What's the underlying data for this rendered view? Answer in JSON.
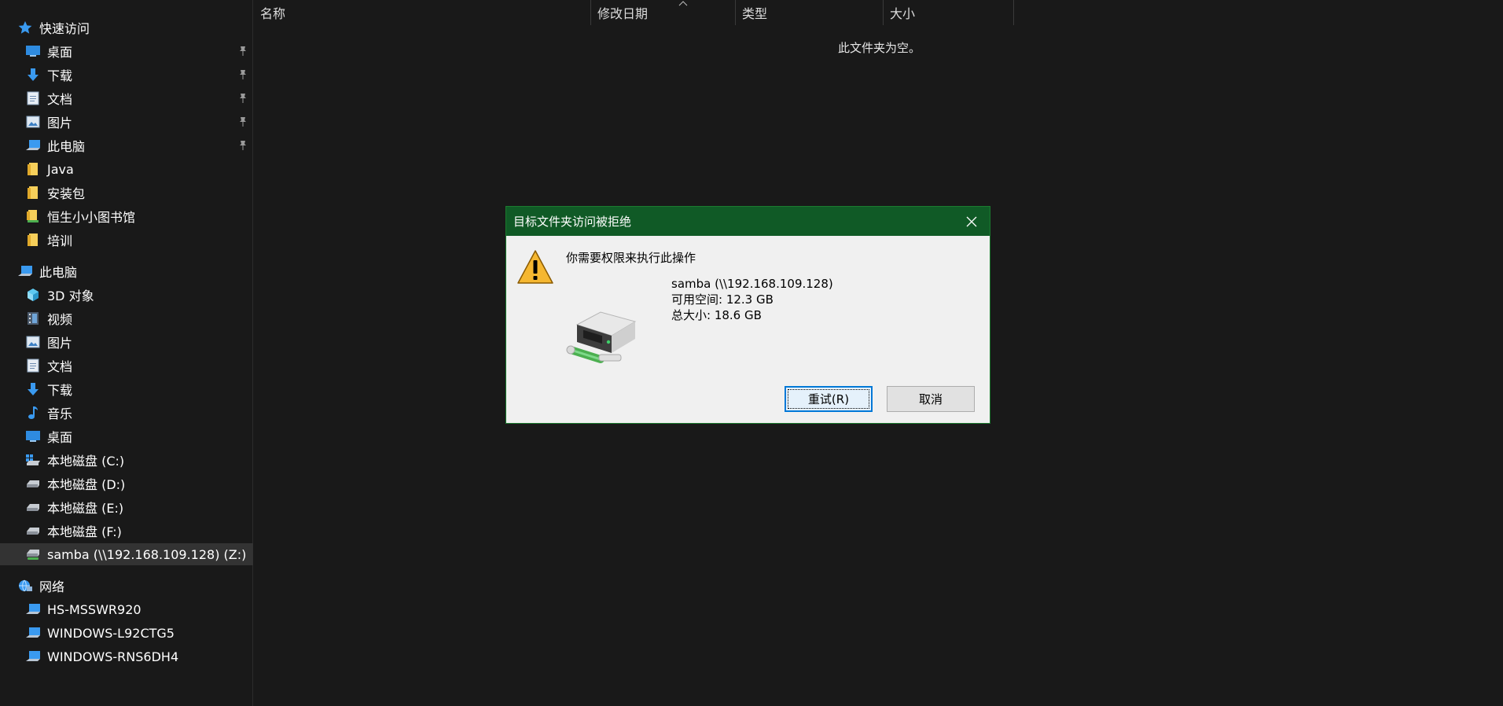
{
  "sidebar": {
    "quick_access": {
      "label": "快速访问",
      "items": [
        {
          "label": "桌面",
          "icon": "desktop-icon"
        },
        {
          "label": "下载",
          "icon": "download-icon"
        },
        {
          "label": "文档",
          "icon": "document-icon"
        },
        {
          "label": "图片",
          "icon": "pictures-icon"
        },
        {
          "label": "此电脑",
          "icon": "computer-icon"
        },
        {
          "label": "Java",
          "icon": "folder-icon"
        },
        {
          "label": "安装包",
          "icon": "folder-icon"
        },
        {
          "label": "恒生小小图书馆",
          "icon": "folder-icon"
        },
        {
          "label": "培训",
          "icon": "folder-icon"
        }
      ]
    },
    "this_pc": {
      "label": "此电脑",
      "items": [
        {
          "label": "3D 对象",
          "icon": "3d-objects-icon"
        },
        {
          "label": "视频",
          "icon": "video-icon"
        },
        {
          "label": "图片",
          "icon": "pictures-icon"
        },
        {
          "label": "文档",
          "icon": "document-icon"
        },
        {
          "label": "下载",
          "icon": "download-icon"
        },
        {
          "label": "音乐",
          "icon": "music-icon"
        },
        {
          "label": "桌面",
          "icon": "desktop-icon"
        },
        {
          "label": "本地磁盘 (C:)",
          "icon": "system-drive-icon"
        },
        {
          "label": "本地磁盘 (D:)",
          "icon": "drive-icon"
        },
        {
          "label": "本地磁盘 (E:)",
          "icon": "drive-icon"
        },
        {
          "label": "本地磁盘 (F:)",
          "icon": "drive-icon"
        },
        {
          "label": "samba (\\\\192.168.109.128) (Z:)",
          "icon": "network-drive-icon"
        }
      ]
    },
    "network": {
      "label": "网络",
      "items": [
        {
          "label": "HS-MSSWR920",
          "icon": "computer-icon"
        },
        {
          "label": "WINDOWS-L92CTG5",
          "icon": "computer-icon"
        },
        {
          "label": "WINDOWS-RNS6DH4",
          "icon": "computer-icon"
        }
      ]
    }
  },
  "file_list": {
    "columns": [
      "名称",
      "修改日期",
      "类型",
      "大小"
    ],
    "empty_message": "此文件夹为空。"
  },
  "dialog": {
    "title": "目标文件夹访问被拒绝",
    "message": "你需要权限来执行此操作",
    "drive_name": "samba (\\\\192.168.109.128)",
    "free_space": "可用空间: 12.3 GB",
    "total_size": "总大小: 18.6 GB",
    "retry_label": "重试(R)",
    "cancel_label": "取消"
  },
  "colors": {
    "dialog_titlebar": "#105a26",
    "dialog_body": "#f0f0f0",
    "explorer_bg": "#191919",
    "selected_row": "#333333",
    "accent_blue": "#0078d7"
  }
}
